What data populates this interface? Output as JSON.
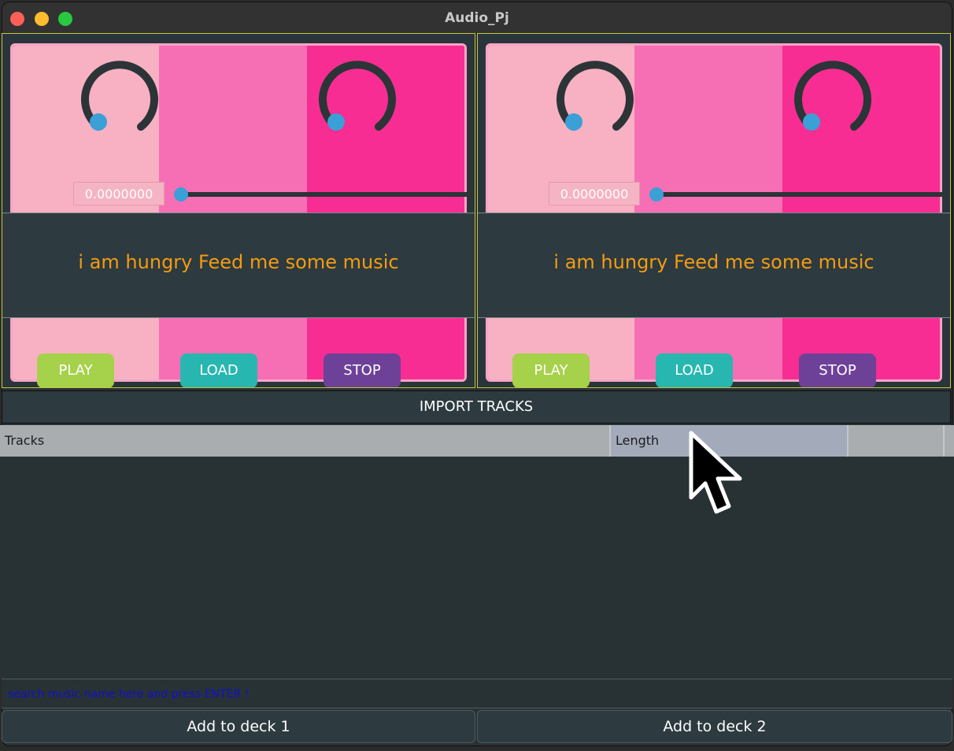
{
  "window": {
    "title": "Audio_Pj"
  },
  "decks": [
    {
      "position_value": "0.0000000",
      "message": "i am hungry Feed me some music",
      "buttons": {
        "play": "PLAY",
        "load": "LOAD",
        "stop": "STOP"
      }
    },
    {
      "position_value": "0.0000000",
      "message": "i am hungry Feed me some music",
      "buttons": {
        "play": "PLAY",
        "load": "LOAD",
        "stop": "STOP"
      }
    }
  ],
  "library": {
    "import_label": "IMPORT TRACKS",
    "columns": [
      "Tracks",
      "Length",
      ""
    ],
    "search_placeholder": "search music name here and press ENTER !",
    "add_deck1": "Add to deck 1",
    "add_deck2": "Add to deck 2"
  },
  "colors": {
    "accent_message": "#f39c12",
    "play": "#a6d14a",
    "load": "#28b6b0",
    "stop": "#6e4199",
    "knob_thumb": "#3aa0d6"
  },
  "icons": [
    "close-icon",
    "minimize-icon",
    "zoom-icon",
    "mouse-pointer-icon"
  ]
}
